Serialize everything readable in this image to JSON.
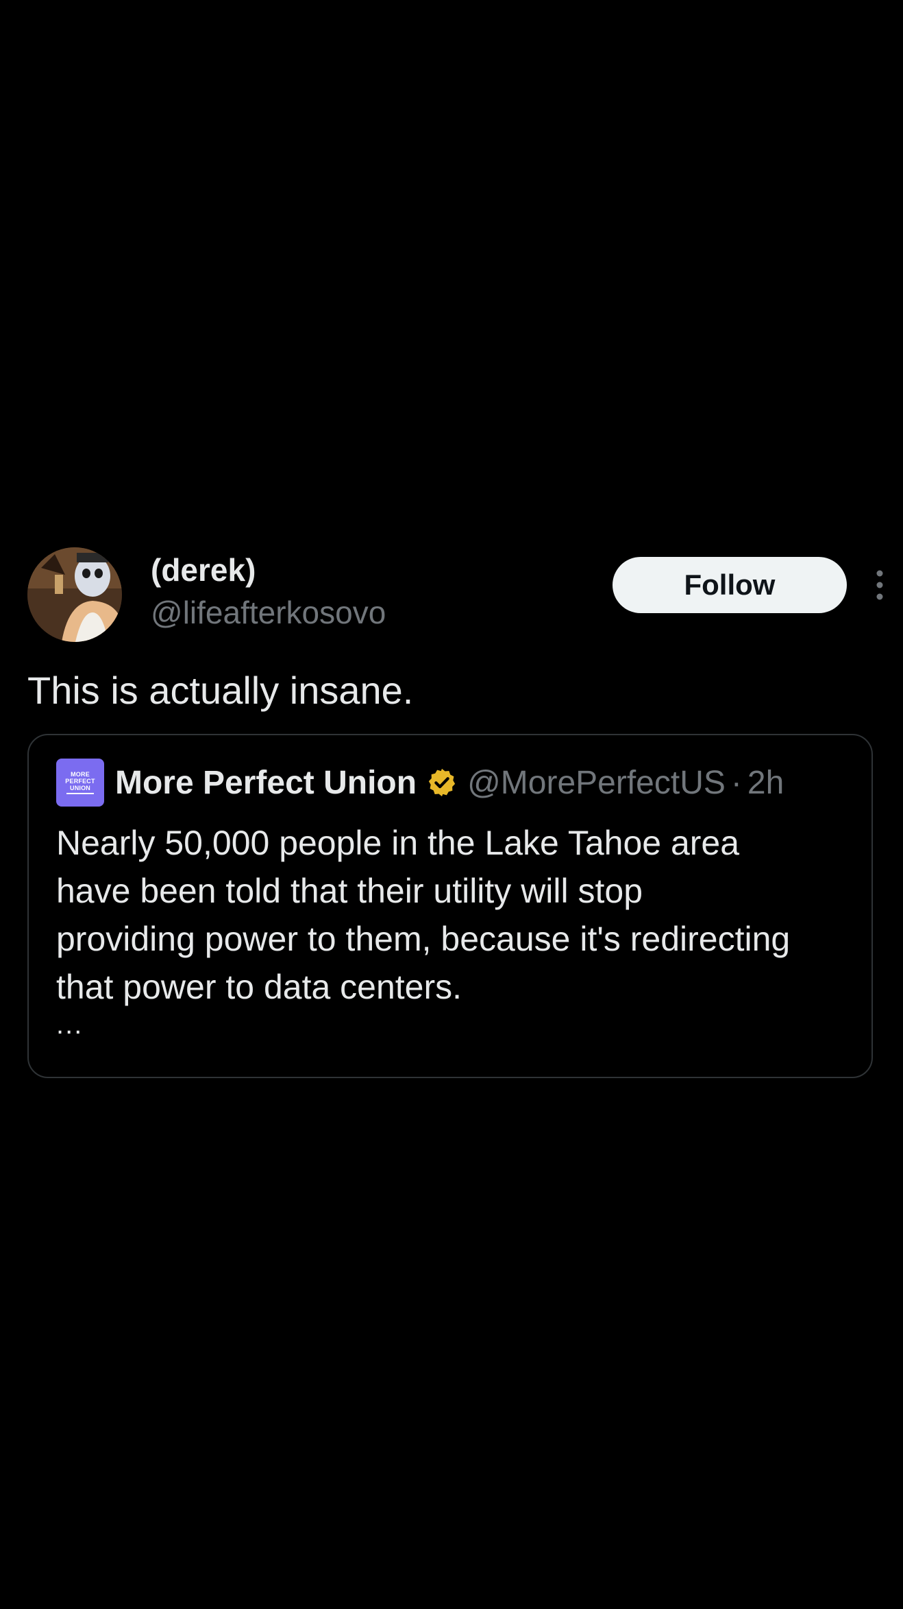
{
  "author": {
    "display_name": "(derek)",
    "handle": "@lifeafterkosovo",
    "avatar_icon": "profile-photo-masked-person"
  },
  "follow_label": "Follow",
  "more_icon": "vertical-ellipsis-icon",
  "tweet_text": "This is actually insane.",
  "quote": {
    "avatar_text": [
      "MORE",
      "PERFECT",
      "UNION"
    ],
    "avatar_color": "#7b6cf0",
    "name": "More Perfect Union",
    "verified_icon": "gold-verified-badge-icon",
    "verified_color": "#e8b829",
    "handle": "@MorePerfectUS",
    "separator": "·",
    "time": "2h",
    "body_lines": [
      "Nearly 50,000 people in the Lake Tahoe area",
      "have been told that their utility will stop",
      "providing power to them, because it's redirecting",
      "that power to data centers."
    ],
    "ellipsis": "..."
  },
  "colors": {
    "background": "#000000",
    "primary_text": "#e7e9ea",
    "secondary_text": "#71767b",
    "border": "#2f3336",
    "follow_bg": "#eff3f4"
  }
}
